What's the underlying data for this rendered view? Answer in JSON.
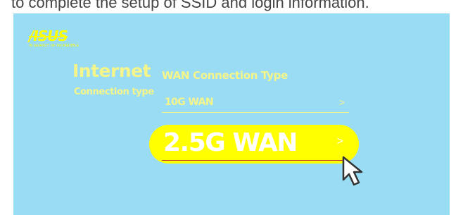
{
  "caption": "to complete the setup of SSID and login information.",
  "brand": {
    "logo": "/ISUS",
    "tagline": "IN SEARCH OF INCREDIBLE"
  },
  "section": {
    "title": "Internet",
    "subtitle": "Connection type"
  },
  "wan": {
    "heading": "WAN Connection Type",
    "options": [
      {
        "label": "10G WAN",
        "chevron": ">"
      },
      {
        "label": "2.5G WAN",
        "chevron": ">"
      }
    ]
  },
  "colors": {
    "panel_bg": "#9adcf4",
    "accent_yellow": "#ffff00",
    "pale_yellow": "#f5f58a"
  },
  "icons": {
    "chevron": "chevron-right-icon",
    "pointer": "mouse-pointer-icon"
  }
}
